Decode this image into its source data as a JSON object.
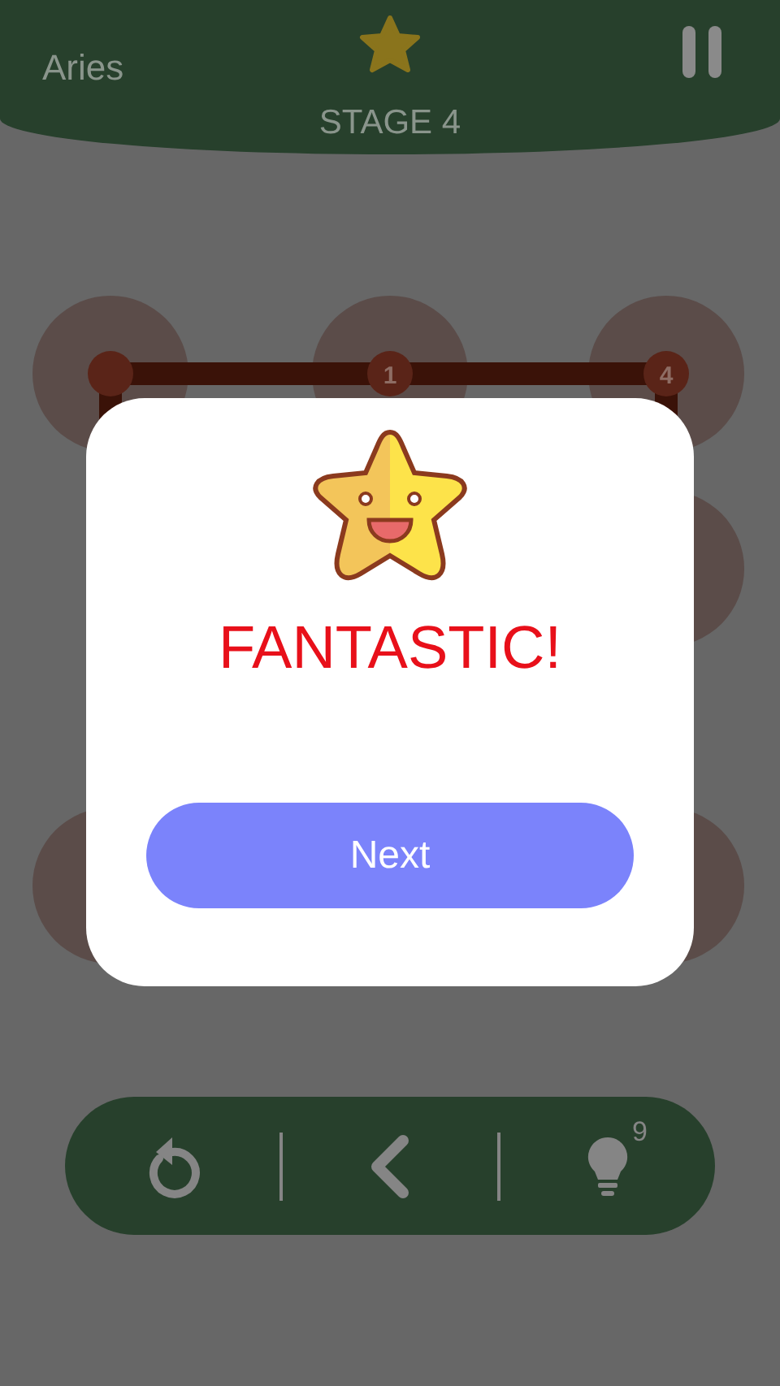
{
  "header": {
    "title": "Aries",
    "stage": "STAGE 4"
  },
  "board": {
    "nodes": [
      {
        "label": "1"
      },
      {
        "label": "4"
      }
    ]
  },
  "dialog": {
    "title": "FANTASTIC!",
    "button": "Next"
  },
  "toolbar": {
    "hint_count": "9"
  }
}
